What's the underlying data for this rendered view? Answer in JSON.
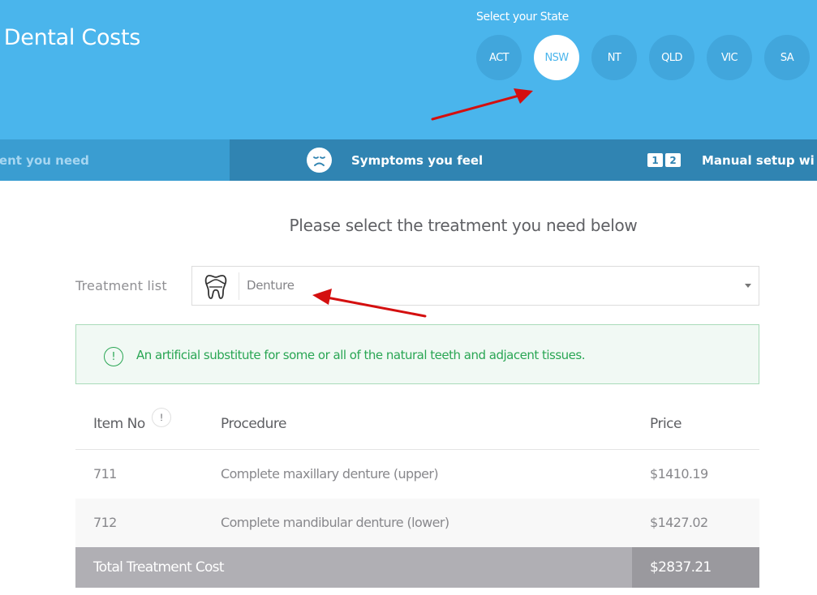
{
  "header": {
    "title": "Dental Costs",
    "state_label": "Select your State",
    "states": [
      {
        "code": "ACT",
        "selected": false
      },
      {
        "code": "NSW",
        "selected": true
      },
      {
        "code": "NT",
        "selected": false
      },
      {
        "code": "QLD",
        "selected": false
      },
      {
        "code": "VIC",
        "selected": false
      },
      {
        "code": "SA",
        "selected": false
      }
    ],
    "brand_color": "#4ab5ec"
  },
  "tabs": [
    {
      "label": "Treatment you need",
      "visible_label": "atment you need",
      "icon": "tooth-icon",
      "active": true
    },
    {
      "label": "Symptoms you feel",
      "icon": "sad-face-icon",
      "active": false
    },
    {
      "label": "Manual setup wi",
      "icon": "numbers-1-2-icon",
      "icon_digits": [
        "1",
        "2"
      ],
      "active": false
    }
  ],
  "main": {
    "subtitle": "Please select the treatment you need below",
    "treatment_list": {
      "label": "Treatment list",
      "selected_value": "Denture",
      "icon": "tooth-icon"
    },
    "info": {
      "icon": "exclamation-circle-icon",
      "text": "An artificial substitute for some or all of the natural teeth and adjacent tissues.",
      "color": "#2aa654"
    },
    "table": {
      "headers": {
        "item_no": "Item No",
        "procedure": "Procedure",
        "price": "Price",
        "help_icon": "!"
      },
      "rows": [
        {
          "item_no": "711",
          "procedure": "Complete maxillary denture (upper)",
          "price": "$1410.19"
        },
        {
          "item_no": "712",
          "procedure": "Complete mandibular denture (lower)",
          "price": "$1427.02"
        }
      ],
      "total": {
        "label": "Total Treatment Cost",
        "value": "$2837.21"
      }
    }
  },
  "annotations": [
    {
      "type": "arrow",
      "target": "state-nsw",
      "color": "#d40f0f"
    },
    {
      "type": "arrow",
      "target": "treatment-select",
      "color": "#d40f0f"
    }
  ]
}
